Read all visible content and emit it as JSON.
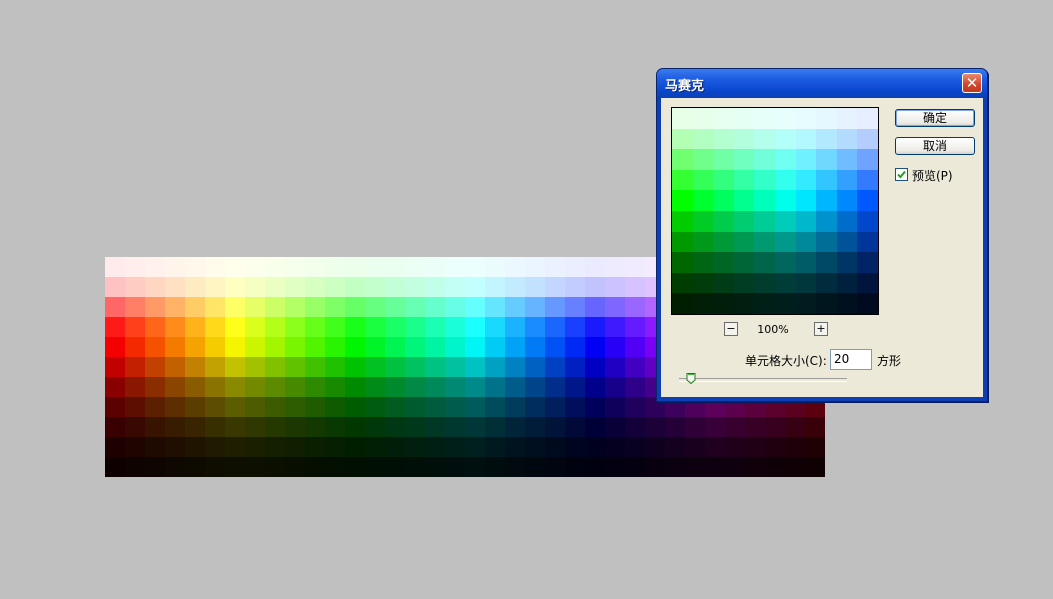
{
  "dialog": {
    "title": "马赛克",
    "close_label": "✕",
    "ok_label": "确定",
    "cancel_label": "取消",
    "preview_label": "预览(P)",
    "preview_checked": true,
    "zoom_minus_label": "−",
    "zoom_plus_label": "+",
    "zoom_level": "100%",
    "cell_size_label": "单元格大小(C):",
    "cell_size_value": "20",
    "unit_label": "方形",
    "slider_value": 20
  },
  "colors": {
    "desktop": "#c0c0c0",
    "title_bar": "#0b3fb3",
    "dialog_face": "#ece9d8",
    "check_mark": "#21a121"
  },
  "icons": [
    "close-icon",
    "check-icon",
    "slider-thumb-icon"
  ]
}
